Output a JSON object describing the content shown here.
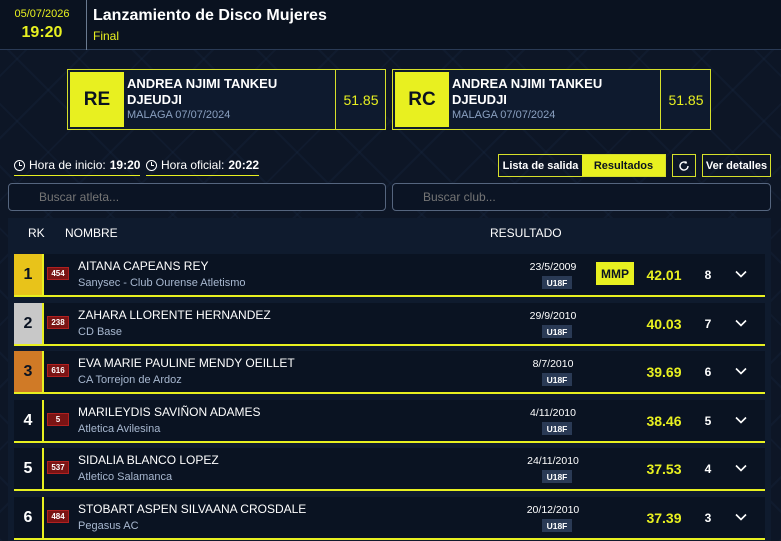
{
  "header": {
    "date": "05/07/2026",
    "time": "19:20",
    "title": "Lanzamiento de Disco Mujeres",
    "round": "Final"
  },
  "records": [
    {
      "badge": "RE",
      "athlete": "ANDREA NJIMI TANKEU DJEUDJI",
      "place_date": "MALAGA  07/07/2024",
      "mark": "51.85"
    },
    {
      "badge": "RC",
      "athlete": "ANDREA NJIMI TANKEU DJEUDJI",
      "place_date": "MALAGA  07/07/2024",
      "mark": "51.85"
    }
  ],
  "times": {
    "start_label": "Hora de inicio:",
    "start_value": "19:20",
    "official_label": "Hora oficial:",
    "official_value": "20:22"
  },
  "controls": {
    "startlist": "Lista de salida",
    "results": "Resultados",
    "details": "Ver detalles",
    "refresh_icon": "refresh-icon"
  },
  "search": {
    "athlete_placeholder": "Buscar atleta...",
    "club_placeholder": "Buscar club..."
  },
  "table": {
    "headers": {
      "rank": "RK",
      "name": "NOMBRE",
      "result": "RESULTADO"
    },
    "rows": [
      {
        "rank": "1",
        "bib": "454",
        "name": "AITANA CAPEANS REY",
        "club": "Sanysec - Club Ourense Atletismo",
        "dob": "23/5/2009",
        "category": "U18F",
        "badge": "MMP",
        "mark": "42.01",
        "points": "8",
        "medal": "gold"
      },
      {
        "rank": "2",
        "bib": "238",
        "name": "ZAHARA LLORENTE HERNANDEZ",
        "club": "CD Base",
        "dob": "29/9/2010",
        "category": "U18F",
        "badge": "",
        "mark": "40.03",
        "points": "7",
        "medal": "silver"
      },
      {
        "rank": "3",
        "bib": "616",
        "name": "EVA MARIE PAULINE MENDY OEILLET",
        "club": "CA Torrejon de Ardoz",
        "dob": "8/7/2010",
        "category": "U18F",
        "badge": "",
        "mark": "39.69",
        "points": "6",
        "medal": "bronze"
      },
      {
        "rank": "4",
        "bib": "5",
        "name": "MARILEYDIS SAVIÑON ADAMES",
        "club": "Atletica Avilesina",
        "dob": "4/11/2010",
        "category": "U18F",
        "badge": "",
        "mark": "38.46",
        "points": "5",
        "medal": ""
      },
      {
        "rank": "5",
        "bib": "537",
        "name": "SIDALIA BLANCO LOPEZ",
        "club": "Atletico Salamanca",
        "dob": "24/11/2010",
        "category": "U18F",
        "badge": "",
        "mark": "37.53",
        "points": "4",
        "medal": ""
      },
      {
        "rank": "6",
        "bib": "484",
        "name": "STOBART ASPEN SILVAANA CROSDALE",
        "club": "Pegasus AC",
        "dob": "20/12/2010",
        "category": "U18F",
        "badge": "",
        "mark": "37.39",
        "points": "3",
        "medal": ""
      }
    ]
  },
  "colors": {
    "accent": "#e8f020",
    "background": "#0d1626",
    "gold": "#e8c31a",
    "silver": "#c8c8c8",
    "bronze": "#d07a26",
    "bib": "#7a1414"
  }
}
